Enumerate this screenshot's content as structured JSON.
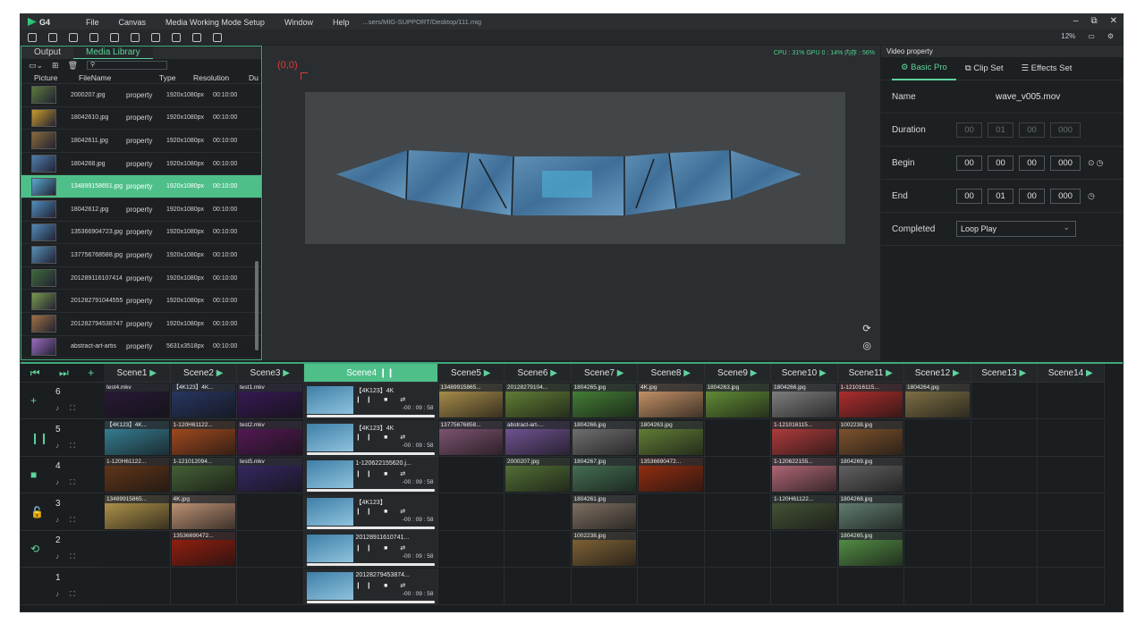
{
  "app": {
    "logo": "G4",
    "menu": [
      "File",
      "Canvas",
      "Media Working Mode Setup",
      "Window",
      "Help"
    ],
    "path": "...sers/MIG-SUPPORT/Desktop/111.mig",
    "zoom": "12%"
  },
  "left_panel": {
    "tabs": [
      "Output",
      "Media Library"
    ],
    "columns": [
      "Picture",
      "FileName",
      "Type",
      "Resolution",
      "Du"
    ],
    "rows": [
      {
        "name": "2000207.jpg",
        "type": "property",
        "res": "1920x1080px",
        "dur": "00:10:00",
        "color": "#5a7a3a"
      },
      {
        "name": "18042610.jpg",
        "type": "property",
        "res": "1920x1080px",
        "dur": "00:10:00",
        "color": "#c99a2a"
      },
      {
        "name": "18042611.jpg",
        "type": "property",
        "res": "1920x1080px",
        "dur": "00:10:00",
        "color": "#8a6a3a"
      },
      {
        "name": "1804268.jpg",
        "type": "property",
        "res": "1920x1080px",
        "dur": "00:10:00",
        "color": "#4e7fae"
      },
      {
        "name": "134899158651.jpg",
        "type": "property",
        "res": "1920x1080px",
        "dur": "00:10:00",
        "color": "#5aa8d0"
      },
      {
        "name": "18042612.jpg",
        "type": "property",
        "res": "1920x1080px",
        "dur": "00:10:00",
        "color": "#4e8fc0"
      },
      {
        "name": "135366904723.jpg",
        "type": "property",
        "res": "1920x1080px",
        "dur": "00:10:00",
        "color": "#4f8ab8"
      },
      {
        "name": "137756768588.jpg",
        "type": "property",
        "res": "1920x1080px",
        "dur": "00:10:00",
        "color": "#5590b8"
      },
      {
        "name": "201289116107414",
        "type": "property",
        "res": "1920x1080px",
        "dur": "00:10:00",
        "color": "#3d6a3a"
      },
      {
        "name": "201282791044555",
        "type": "property",
        "res": "1920x1080px",
        "dur": "00:10:00",
        "color": "#7a9a4a"
      },
      {
        "name": "201282794538747",
        "type": "property",
        "res": "1920x1080px",
        "dur": "00:10:00",
        "color": "#a07040"
      },
      {
        "name": "abstract-art-artis",
        "type": "property",
        "res": "5631x3518px",
        "dur": "00:10:00",
        "color": "#9a6ac0"
      }
    ]
  },
  "canvas": {
    "perf": "CPU : 31%   GPU 0 : 14%   内存 : 56%",
    "origin": "(0,0)"
  },
  "right_panel": {
    "title": "Video property",
    "tabs": [
      "Basic Pro",
      "Clip Set",
      "Effects Set"
    ],
    "name_label": "Name",
    "name_value": "wave_v005.mov",
    "duration_label": "Duration",
    "duration": [
      "00",
      "01",
      "00",
      "000"
    ],
    "begin_label": "Begin",
    "begin": [
      "00",
      "00",
      "00",
      "000"
    ],
    "end_label": "End",
    "end": [
      "00",
      "01",
      "00",
      "000"
    ],
    "completed_label": "Completed",
    "completed_value": "Loop Play"
  },
  "grid": {
    "scenes": [
      "Scene1",
      "Scene2",
      "Scene3",
      "Scene4",
      "Scene5",
      "Scene6",
      "Scene7",
      "Scene8",
      "Scene9",
      "Scene10",
      "Scene11",
      "Scene12",
      "Scene13",
      "Scene14"
    ],
    "layers": [
      "6",
      "5",
      "4",
      "3",
      "2",
      "1"
    ],
    "playing": [
      {
        "name": "【4K123】4K",
        "time": "-00 : 09 : 58"
      },
      {
        "name": "【4K123】4K",
        "time": "-00 : 09 : 58"
      },
      {
        "name": "1-120622155620.j...",
        "time": "-00 : 09 : 58"
      },
      {
        "name": "【4K123】",
        "time": "-00 : 09 : 58"
      },
      {
        "name": "20128911610741...",
        "time": "-00 : 09 : 58"
      },
      {
        "name": "20128279453874...",
        "time": "-00 : 09 : 58"
      }
    ],
    "clips": [
      {
        "scene": 0,
        "layer": 0,
        "label": "test4.mkv",
        "color": "#2a1a3a"
      },
      {
        "scene": 1,
        "layer": 0,
        "label": "【4K123】4K...",
        "color": "#2a3a6a"
      },
      {
        "scene": 2,
        "layer": 0,
        "label": "test1.mkv",
        "color": "#3a1a5a"
      },
      {
        "scene": 4,
        "layer": 0,
        "label": "13489915865...",
        "color": "#b89a50"
      },
      {
        "scene": 5,
        "layer": 0,
        "label": "20128279104...",
        "color": "#6a8a3a"
      },
      {
        "scene": 6,
        "layer": 0,
        "label": "1804265.jpg",
        "color": "#4a8a3a"
      },
      {
        "scene": 7,
        "layer": 0,
        "label": "4K.jpg",
        "color": "#d8a070"
      },
      {
        "scene": 8,
        "layer": 0,
        "label": "1804263.jpg",
        "color": "#6a9a3a"
      },
      {
        "scene": 9,
        "layer": 0,
        "label": "1804266.jpg",
        "color": "#8a8a8a"
      },
      {
        "scene": 10,
        "layer": 0,
        "label": "1-121016115...",
        "color": "#c03030"
      },
      {
        "scene": 11,
        "layer": 0,
        "label": "1804264.jpg",
        "color": "#8a7a4a"
      },
      {
        "scene": 0,
        "layer": 1,
        "label": "【4K123】4K...",
        "color": "#3a8aa0"
      },
      {
        "scene": 1,
        "layer": 1,
        "label": "1-120H61122...",
        "color": "#b05020"
      },
      {
        "scene": 2,
        "layer": 1,
        "label": "test2.mkv",
        "color": "#5a1a5a"
      },
      {
        "scene": 4,
        "layer": 1,
        "label": "13775676858...",
        "color": "#8a5a7a"
      },
      {
        "scene": 5,
        "layer": 1,
        "label": "abstract-art-...",
        "color": "#7a5aa0"
      },
      {
        "scene": 6,
        "layer": 1,
        "label": "1804266.jpg",
        "color": "#7a7a7a"
      },
      {
        "scene": 7,
        "layer": 1,
        "label": "1804263.jpg",
        "color": "#6a8a3a"
      },
      {
        "scene": 9,
        "layer": 1,
        "label": "1-121016115...",
        "color": "#c04040"
      },
      {
        "scene": 10,
        "layer": 1,
        "label": "1002238.jpg",
        "color": "#8a5a30"
      },
      {
        "scene": 0,
        "layer": 2,
        "label": "1-120H61122...",
        "color": "#6a3a1a"
      },
      {
        "scene": 1,
        "layer": 2,
        "label": "1-121012094...",
        "color": "#4a6a3a"
      },
      {
        "scene": 2,
        "layer": 2,
        "label": "test5.mkv",
        "color": "#3a2a6a"
      },
      {
        "scene": 5,
        "layer": 2,
        "label": "2000207.jpg",
        "color": "#5a7a3a"
      },
      {
        "scene": 6,
        "layer": 2,
        "label": "1804267.jpg",
        "color": "#4a7a5a"
      },
      {
        "scene": 7,
        "layer": 2,
        "label": "13536690472...",
        "color": "#a03010"
      },
      {
        "scene": 9,
        "layer": 2,
        "label": "1-120622155...",
        "color": "#c07080"
      },
      {
        "scene": 10,
        "layer": 2,
        "label": "1804269.jpg",
        "color": "#6a6a6a"
      },
      {
        "scene": 0,
        "layer": 3,
        "label": "13489915865...",
        "color": "#c0a050"
      },
      {
        "scene": 1,
        "layer": 3,
        "label": "4K.jpg",
        "color": "#d0a080"
      },
      {
        "scene": 6,
        "layer": 3,
        "label": "1804261.jpg",
        "color": "#8a7a6a"
      },
      {
        "scene": 9,
        "layer": 3,
        "label": "1-120H61122...",
        "color": "#4a5a3a"
      },
      {
        "scene": 10,
        "layer": 3,
        "label": "1804268.jpg",
        "color": "#6a8a7a"
      },
      {
        "scene": 1,
        "layer": 4,
        "label": "13536690472...",
        "color": "#a02010"
      },
      {
        "scene": 6,
        "layer": 4,
        "label": "1002238.jpg",
        "color": "#8a6a3a"
      },
      {
        "scene": 10,
        "layer": 4,
        "label": "1804265.jpg",
        "color": "#5a9a4a"
      }
    ]
  }
}
